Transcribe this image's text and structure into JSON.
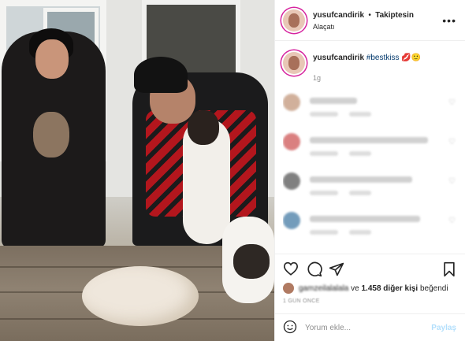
{
  "post": {
    "username": "yusufcandirik",
    "follow_status": "Takiptesin",
    "location": "Alaçatı",
    "caption_username": "yusufcandirik",
    "caption_hashtag": "#bestkiss",
    "caption_emoji": "💋🙂",
    "caption_time": "1g"
  },
  "comments": [
    {
      "avatar_color": "#c9a38a",
      "line_width": 60
    },
    {
      "avatar_color": "#d46a6a",
      "line_width": 150
    },
    {
      "avatar_color": "#6b6b6b",
      "line_width": 130
    },
    {
      "avatar_color": "#5b8bb0",
      "line_width": 140
    }
  ],
  "likes": {
    "first_liker": "gamzeilalalala",
    "connector": "ve",
    "others": "1.458 diğer kişi",
    "suffix": "beğendi"
  },
  "post_date": "1 GÜN ÖNCE",
  "comment_input": {
    "placeholder": "Yorum ekle..."
  },
  "share_label": "Paylaş",
  "icons": {
    "more": "more-icon",
    "like": "heart-icon",
    "comment": "comment-icon",
    "share": "paper-plane-icon",
    "save": "bookmark-icon",
    "emoji": "smiley-icon"
  }
}
